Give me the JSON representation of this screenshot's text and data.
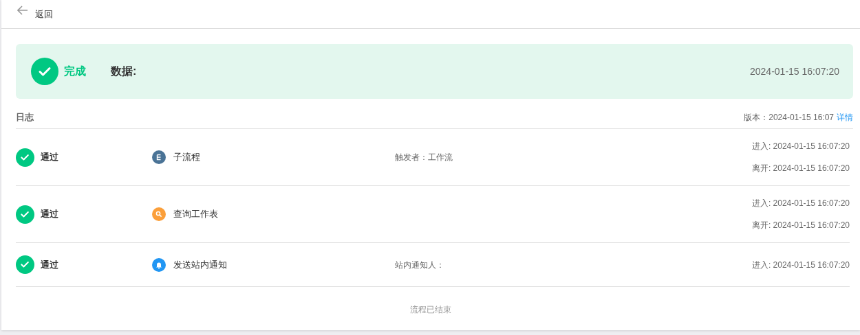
{
  "header": {
    "back_label": "返回"
  },
  "result": {
    "status": "完成",
    "data_label": "数据:",
    "time": "2024-01-15 16:07:20"
  },
  "log": {
    "title": "日志",
    "version": "版本：2024-01-15 16:07",
    "details_link": "详情"
  },
  "steps": [
    {
      "status": "通过",
      "kind": "subflow",
      "node": "子流程",
      "info": "触发者：工作流",
      "times": [
        "进入: 2024-01-15 16:07:20",
        "离开: 2024-01-15 16:07:20"
      ]
    },
    {
      "status": "通过",
      "kind": "search",
      "node": "查询工作表",
      "times": [
        "进入: 2024-01-15 16:07:20",
        "离开: 2024-01-15 16:07:20"
      ]
    },
    {
      "status": "通过",
      "kind": "notify",
      "node": "发送站内通知",
      "info": "站内通知人：",
      "times": [
        "进入: 2024-01-15 16:07:20"
      ]
    }
  ],
  "footer": "流程已结束"
}
